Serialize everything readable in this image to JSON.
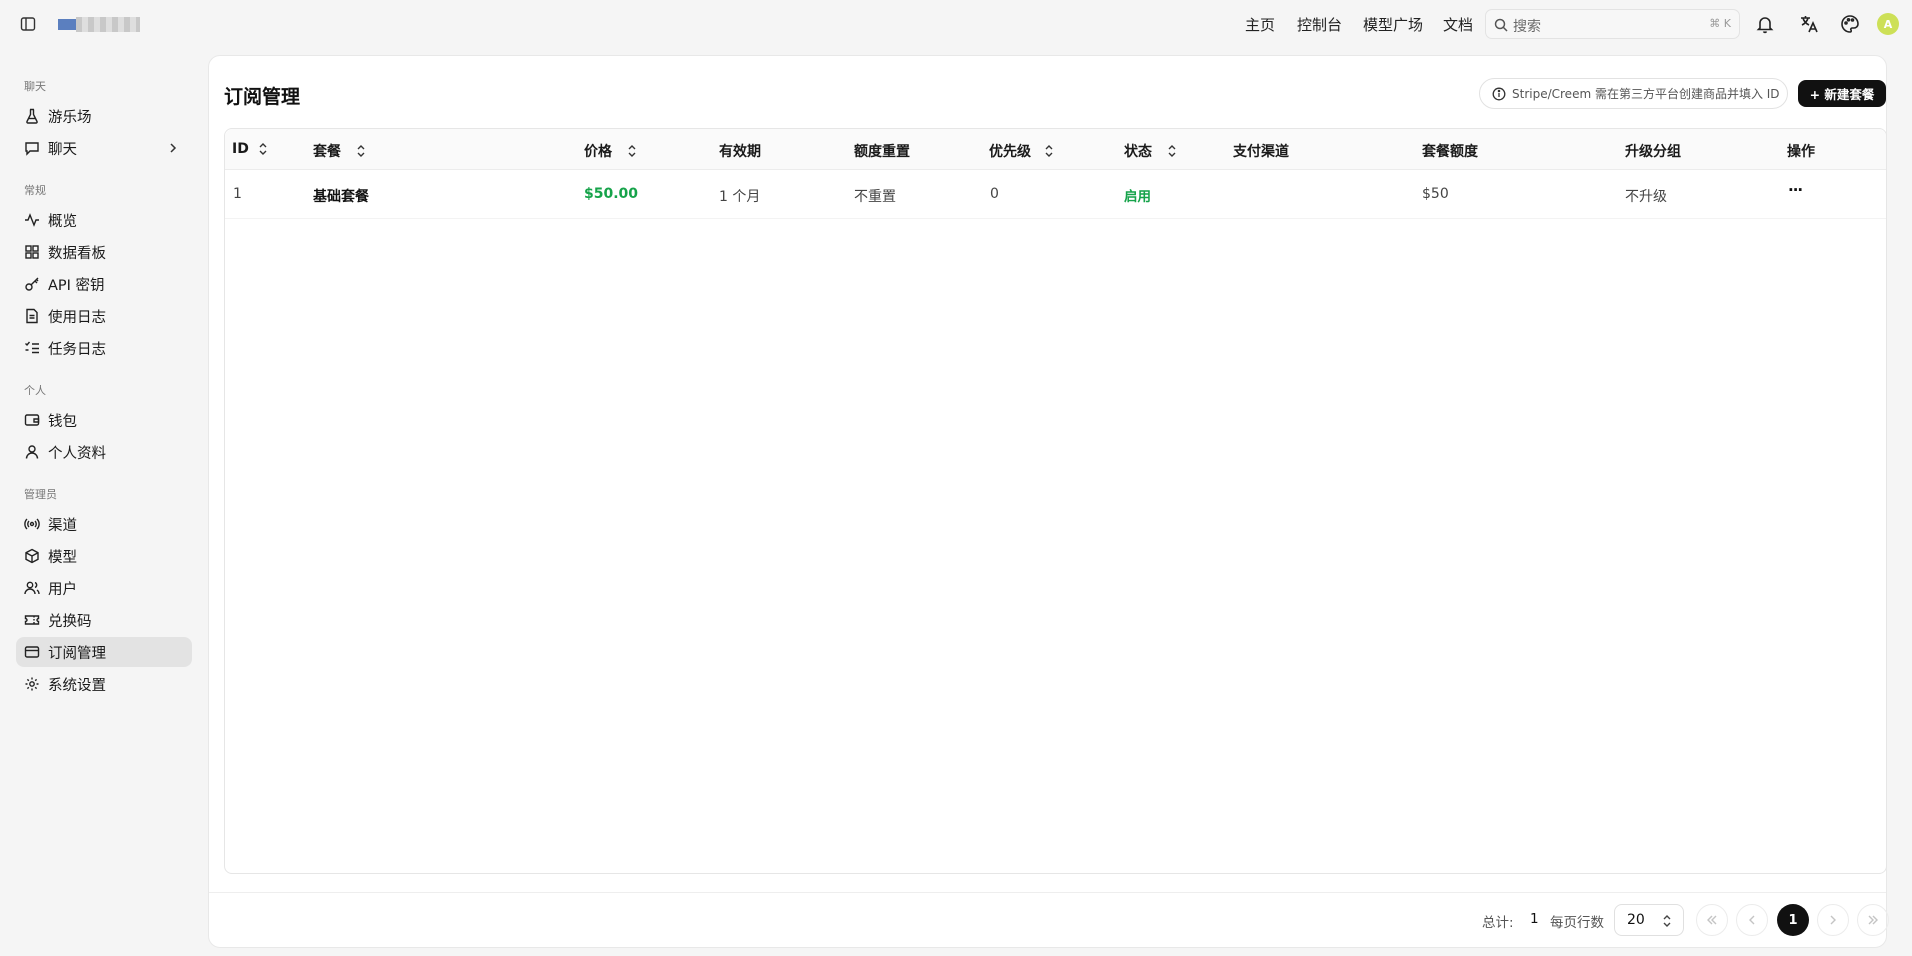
{
  "top_nav": {
    "items": [
      "主页",
      "控制台",
      "模型广场",
      "文档"
    ],
    "search_placeholder": "搜索",
    "search_shortcut": "⌘ K",
    "avatar_initial": "A"
  },
  "sidebar": {
    "sections": [
      {
        "title": "聊天",
        "items": [
          {
            "label": "游乐场",
            "icon": "flask-icon"
          },
          {
            "label": "聊天",
            "icon": "chat-icon",
            "expandable": true
          }
        ]
      },
      {
        "title": "常规",
        "items": [
          {
            "label": "概览",
            "icon": "activity-icon"
          },
          {
            "label": "数据看板",
            "icon": "dashboard-icon"
          },
          {
            "label": "API 密钥",
            "icon": "key-icon"
          },
          {
            "label": "使用日志",
            "icon": "file-icon"
          },
          {
            "label": "任务日志",
            "icon": "list-check-icon"
          }
        ]
      },
      {
        "title": "个人",
        "items": [
          {
            "label": "钱包",
            "icon": "wallet-icon"
          },
          {
            "label": "个人资料",
            "icon": "user-icon"
          }
        ]
      },
      {
        "title": "管理员",
        "items": [
          {
            "label": "渠道",
            "icon": "radio-icon"
          },
          {
            "label": "模型",
            "icon": "cube-icon"
          },
          {
            "label": "用户",
            "icon": "users-icon"
          },
          {
            "label": "兑换码",
            "icon": "ticket-icon"
          },
          {
            "label": "订阅管理",
            "icon": "card-icon",
            "active": true
          },
          {
            "label": "系统设置",
            "icon": "gear-icon"
          }
        ]
      }
    ]
  },
  "page": {
    "title": "订阅管理",
    "notice": "Stripe/Creem 需在第三方平台创建商品并填入 ID",
    "new_button": "+ 新建套餐"
  },
  "table": {
    "columns": [
      "ID",
      "套餐",
      "价格",
      "有效期",
      "额度重置",
      "优先级",
      "状态",
      "支付渠道",
      "套餐额度",
      "升级分组",
      "操作"
    ],
    "sortable": [
      "ID",
      "套餐",
      "价格",
      "优先级",
      "状态"
    ],
    "rows": [
      {
        "id": "1",
        "plan": "基础套餐",
        "price": "$50.00",
        "duration": "1 个月",
        "reset": "不重置",
        "priority": "0",
        "status": "启用",
        "channel": "",
        "quota": "$50",
        "upgrade_group": "不升级",
        "actions": "···"
      }
    ]
  },
  "footer": {
    "total_label": "总计:",
    "total_value": "1",
    "per_page_label": "每页行数",
    "per_page_value": "20",
    "current_page": "1"
  },
  "colors": {
    "accent_green": "#16a34a",
    "primary_dark": "#111111",
    "avatar": "#cde057"
  }
}
